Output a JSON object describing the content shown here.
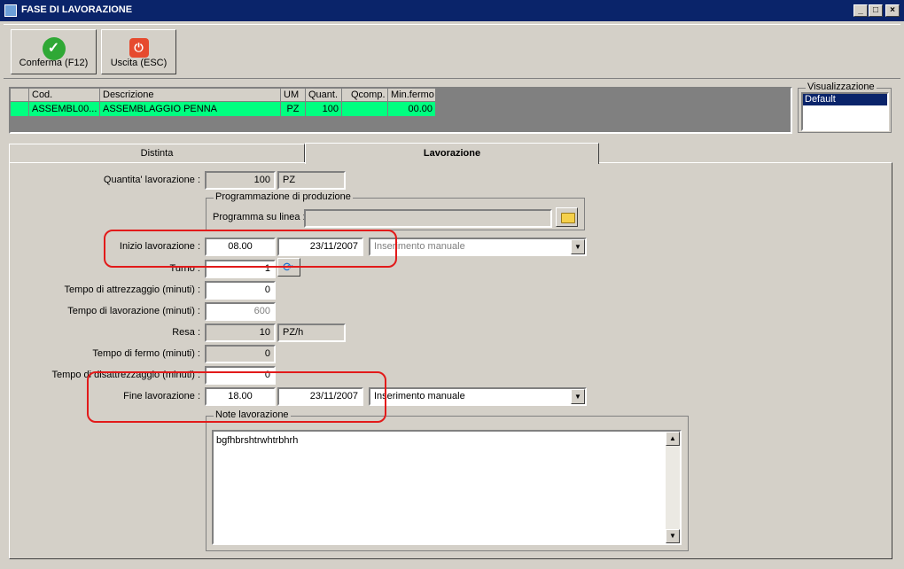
{
  "window": {
    "title": "FASE DI LAVORAZIONE",
    "min": "_",
    "max": "□",
    "close": "×"
  },
  "toolbar": {
    "confirm_label": "Conferma (F12)",
    "exit_label": "Uscita (ESC)"
  },
  "grid": {
    "columns": [
      "Cod.",
      "Descrizione",
      "UM",
      "Quant.",
      "Qcomp.",
      "Min.fermo"
    ],
    "row": [
      "ASSEMBL00...",
      "ASSEMBLAGGIO PENNA",
      "PZ",
      "100",
      "",
      "00.00"
    ]
  },
  "view": {
    "title": "Visualizzazione",
    "items": [
      "Default"
    ]
  },
  "tabs": [
    "Distinta",
    "Lavorazione"
  ],
  "form": {
    "qty_label": "Quantita' lavorazione :",
    "qty_value": "100",
    "qty_unit": "PZ",
    "prog_group": "Programmazione di produzione",
    "prog_label": "Programma su linea :",
    "prog_value": "",
    "start_label": "Inizio lavorazione :",
    "start_time": "08.00",
    "start_date": "23/11/2007",
    "start_mode": "Inserimento manuale",
    "turn_label": "Turno :",
    "turn_value": "1",
    "setup_label": "Tempo di attrezzaggio (minuti) :",
    "setup_value": "0",
    "work_label": "Tempo di lavorazione (minuti) :",
    "work_value": "600",
    "yield_label": "Resa :",
    "yield_value": "10",
    "yield_unit": "PZ/h",
    "stop_label": "Tempo di fermo (minuti) :",
    "stop_value": "0",
    "teardown_label": "Tempo di disattrezzaggio (minuti) :",
    "teardown_value": "0",
    "end_label": "Fine lavorazione :",
    "end_time": "18.00",
    "end_date": "23/11/2007",
    "end_mode": "Inserimento manuale",
    "notes_group": "Note lavorazione",
    "notes_text": "bgfhbrshtrwhtrbhrh"
  },
  "colors": {
    "title_bar": "#0a246a",
    "selected_row": "#00ff80",
    "highlight": "#e21a1a"
  }
}
